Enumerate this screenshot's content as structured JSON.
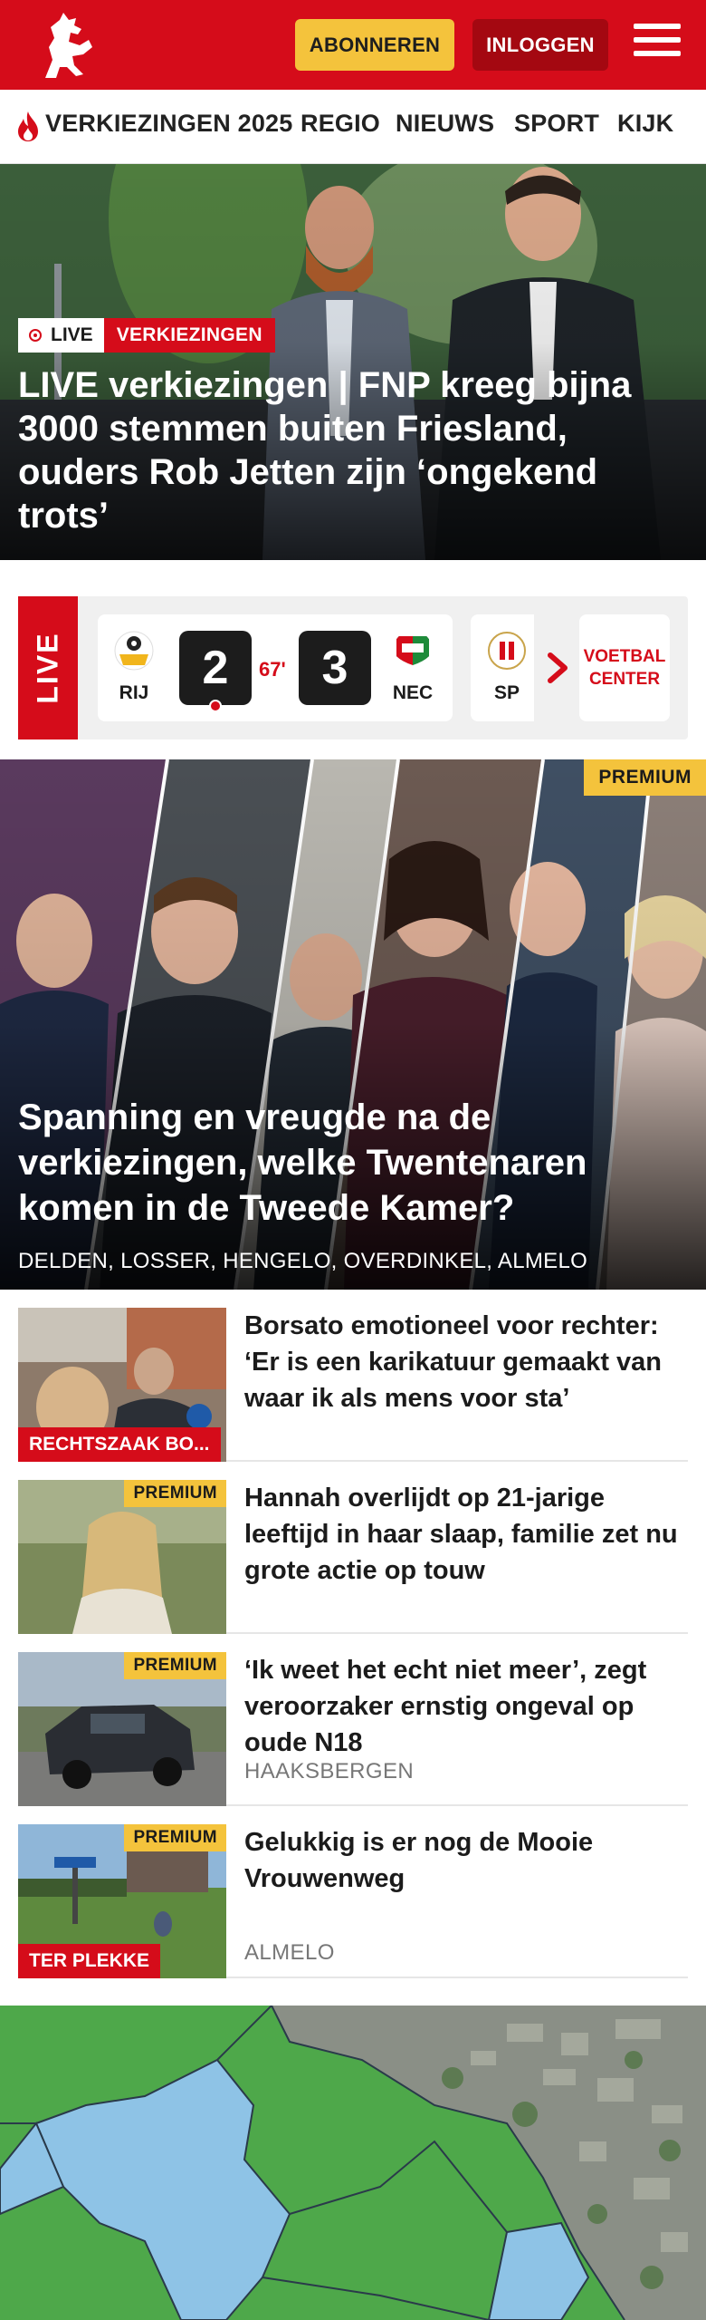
{
  "header": {
    "subscribe_label": "ABONNEREN",
    "login_label": "INLOGGEN",
    "brand_color": "#d50c1a"
  },
  "nav": {
    "items": [
      {
        "label": "VERKIEZINGEN 2025",
        "icon": "flame-icon"
      },
      {
        "label": "REGIO"
      },
      {
        "label": "NIEUWS"
      },
      {
        "label": "SPORT"
      },
      {
        "label": "KIJK"
      }
    ]
  },
  "hero": {
    "live_label": "LIVE",
    "category": "VERKIEZINGEN",
    "title": "LIVE verkiezingen | FNP kreeg bijna 3000 stemmen buiten Friesland, ouders Rob Jetten zijn ‘ongekend trots’"
  },
  "live_scores": {
    "strip_label": "LIVE",
    "match": {
      "home_abbr": "RIJ",
      "away_abbr": "NEC",
      "home_score": "2",
      "away_score": "3",
      "minute": "67'"
    },
    "next_match_abbr": "SP",
    "voetbal_center_label": "VOETBAL CENTER"
  },
  "feature": {
    "badge": "PREMIUM",
    "title": "Spanning en vreugde na de verkiezingen, welke Twentenaren komen in de Tweede Kamer?",
    "locations": "DELDEN, LOSSER, HENGELO, OVERDINKEL, ALMELO"
  },
  "articles": [
    {
      "title": "Borsato emotioneel voor rechter: ‘Er is een karikatuur gemaakt van waar ik als mens voor sta’",
      "tag": "RECHTSZAAK BO...",
      "premium": "",
      "location": ""
    },
    {
      "title": "Hannah overlijdt op 21-jarige leeftijd in haar slaap, familie zet nu grote actie op touw",
      "tag": "",
      "premium": "PREMIUM",
      "location": ""
    },
    {
      "title": "‘Ik weet het echt niet meer’, zegt veroorzaker ernstig ongeval op oude N18",
      "tag": "",
      "premium": "PREMIUM",
      "location": "HAAKSBERGEN"
    },
    {
      "title": "Gelukkig is er nog de Mooie Vrouwenweg",
      "tag": "TER PLEKKE",
      "premium": "PREMIUM",
      "location": "ALMELO"
    }
  ],
  "colors": {
    "accent_red": "#d50c1a",
    "premium_yellow": "#f4c33c",
    "dark_red": "#a40811"
  }
}
